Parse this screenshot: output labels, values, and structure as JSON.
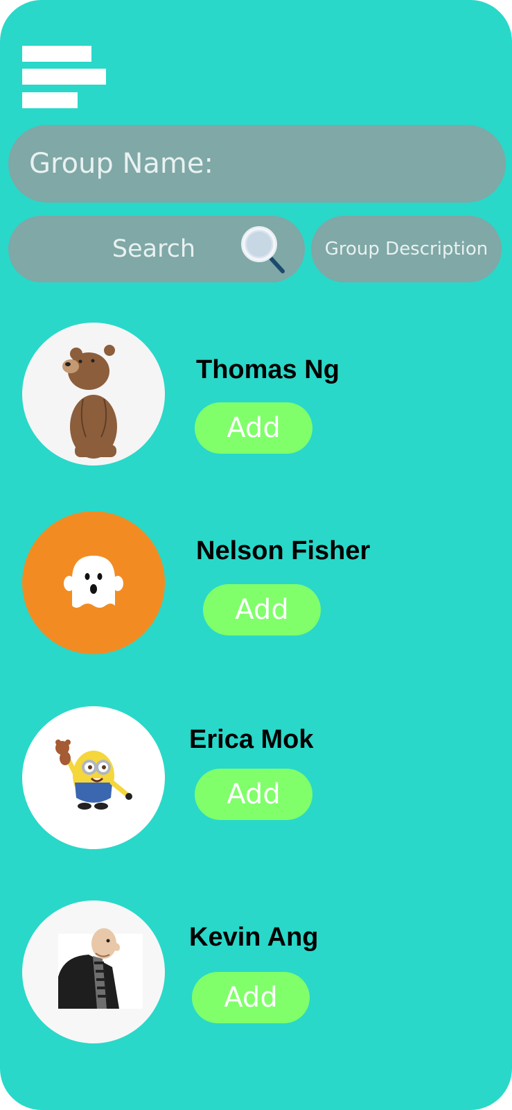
{
  "header": {
    "menu_icon": "hamburger-menu-icon"
  },
  "form": {
    "group_name_label": "Group Name:",
    "search_label": "Search",
    "search_icon": "magnifier-icon",
    "group_description_label": "Group Description"
  },
  "contacts": [
    {
      "name": "Thomas Ng",
      "add_label": "Add",
      "avatar": "brown-bear-avatar"
    },
    {
      "name": "Nelson Fisher",
      "add_label": "Add",
      "avatar": "ghost-avatar"
    },
    {
      "name": "Erica Mok",
      "add_label": "Add",
      "avatar": "minion-avatar"
    },
    {
      "name": "Kevin Ang",
      "add_label": "Add",
      "avatar": "gru-avatar"
    }
  ],
  "colors": {
    "background": "#29d8c9",
    "pill": "#7fa8a6",
    "add_button": "#80ff6a",
    "ghost_avatar_bg": "#f28c22"
  }
}
